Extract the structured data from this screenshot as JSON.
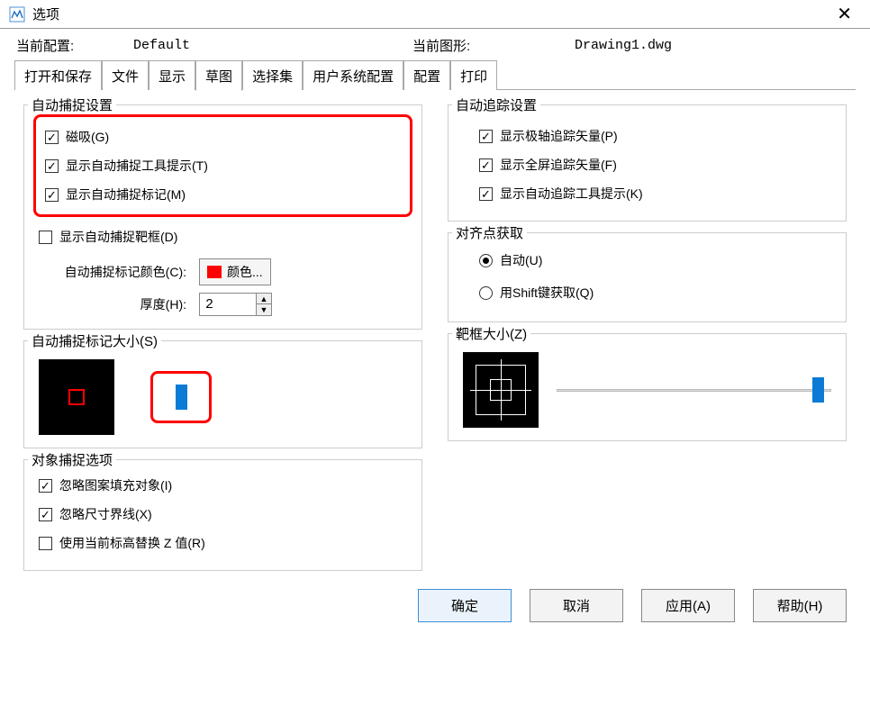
{
  "window": {
    "title": "选项"
  },
  "config": {
    "current_profile_label": "当前配置:",
    "current_profile_value": "Default",
    "current_drawing_label": "当前图形:",
    "current_drawing_value": "Drawing1.dwg"
  },
  "tabs": [
    "打开和保存",
    "文件",
    "显示",
    "草图",
    "选择集",
    "用户系统配置",
    "配置",
    "打印"
  ],
  "active_tab_index": 3,
  "autosnap": {
    "group_title": "自动捕捉设置",
    "magnet": "磁吸(G)",
    "tooltip": "显示自动捕捉工具提示(T)",
    "marker": "显示自动捕捉标记(M)",
    "aperture": "显示自动捕捉靶框(D)",
    "marker_color_label": "自动捕捉标记颜色(C):",
    "color_btn": "颜色...",
    "thickness_label": "厚度(H):",
    "thickness_value": "2",
    "marker_size_group": "自动捕捉标记大小(S)",
    "marker_color_hex": "#ff0000"
  },
  "autotrack": {
    "group_title": "自动追踪设置",
    "polar": "显示极轴追踪矢量(P)",
    "fullscreen": "显示全屏追踪矢量(F)",
    "tooltip": "显示自动追踪工具提示(K)"
  },
  "alignment": {
    "group_title": "对齐点获取",
    "auto": "自动(U)",
    "shift": "用Shift键获取(Q)"
  },
  "aperture_size": {
    "group_title": "靶框大小(Z)"
  },
  "osnap_options": {
    "group_title": "对象捕捉选项",
    "ignore_hatch": "忽略图案填充对象(I)",
    "ignore_dim": "忽略尺寸界线(X)",
    "replace_z": "使用当前标高替换 Z 值(R)"
  },
  "buttons": {
    "ok": "确定",
    "cancel": "取消",
    "apply": "应用(A)",
    "help": "帮助(H)"
  }
}
